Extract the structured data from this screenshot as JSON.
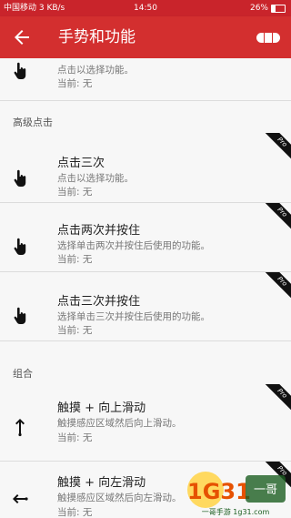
{
  "status": {
    "left": "中国移动 3 KB/s",
    "time": "14:50",
    "battery": "26%"
  },
  "toolbar": {
    "title": "手势和功能"
  },
  "sections": [
    "高级点击",
    "组合"
  ],
  "items": [
    {
      "title": "",
      "subtitle": "点击以选择功能。",
      "current": "当前: 无",
      "pro": ""
    },
    {
      "title": "点击三次",
      "subtitle": "点击以选择功能。",
      "current": "当前: 无",
      "pro": "Pro"
    },
    {
      "title": "点击两次并按住",
      "subtitle": "选择单击两次并按住后使用的功能。",
      "current": "当前: 无",
      "pro": "Pro"
    },
    {
      "title": "点击三次并按住",
      "subtitle": "选择单击三次并按住后使用的功能。",
      "current": "当前: 无",
      "pro": "Pro"
    },
    {
      "title": "触摸 + 向上滑动",
      "subtitle": "触摸感应区域然后向上滑动。",
      "current": "当前: 无",
      "pro": "Pro"
    },
    {
      "title": "触摸 + 向左滑动",
      "subtitle": "触摸感应区域然后向左滑动。",
      "current": "当前: 无",
      "pro": "Pro"
    }
  ],
  "watermark": {
    "text": "1G31 一哥手游",
    "url": "一哥手游 1g31.com"
  }
}
